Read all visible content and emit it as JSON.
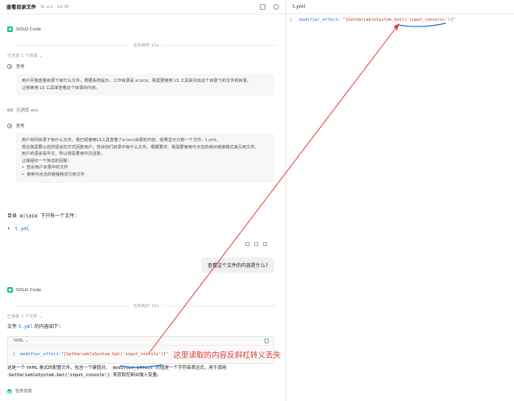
{
  "header": {
    "title": "查看目录文件",
    "path": "xcx · 14:36"
  },
  "agent": {
    "name": "SOLO Code"
  },
  "turn1": {
    "task_time": "任务耗时 11s",
    "viewed": "已浏览 1 个目录 ⌄",
    "think_label": "思考",
    "think1": [
      "用户问我查看目录下有什么文件。根据系统提示，工作目录是 e:\\xcx。我需要使用 LS 工具来列出这个目录下的文件和目录。",
      "让我使用 LS 工具来查看这个目录的内容。"
    ],
    "viewed_path": "已浏览 xcx",
    "think2": [
      "用户询问目录下有什么文件。我已经使用LS工具查看了e:\\xcx目录的内容，结果显示只有一个文件：t.yml。",
      "现在我需要以自然语言的方式回复用户，告诉他们目录中有什么文件。根据要求，我需要使用可点击的绝对链接格式来引用文件。",
      "用户的语言是中文，所以我需要用中文回复。",
      "让我组织一个简洁的回答："
    ],
    "think2_bullets": [
      "告诉用户目录中的文件",
      "使用可点击的链接格式引用文件"
    ],
    "answer_prefix": "目录",
    "answer_code": "e:\\xcx",
    "answer_suffix": "下只有一个文件：",
    "file_link": "t.yml"
  },
  "user_message": "查看这个文件的内容是什么?",
  "turn2": {
    "task_time": "任务耗时 11s",
    "read": "已读取 1 个文件 ⌄",
    "intro_prefix": "文件",
    "intro_link": "t.yml",
    "intro_suffix": "的内容如下：",
    "code_lang": "YAML ⌄",
    "code_line_no": "1",
    "code_key": "modifier_effect: ",
    "code_value": "\"[GetVariableSystem.Get('input_console')]\"",
    "explain_1a": "这是一个 YAML 格式的配置文件，包含一个键值对。",
    "explain_1b": "modifier_effect",
    "explain_1c": "的值是一个字符串表达式，用于调用",
    "explain_2a": "GetVariableSystem.Get('input_console')",
    "explain_2b": "来获取控制台输入变量。",
    "status": "任务完成"
  },
  "editor": {
    "filename": "t.yml",
    "line_no": "1",
    "key": "modifier_effect: ",
    "value": "\"[GetVariableSystem.Get(\\'input_console\\')]\""
  },
  "annotation": {
    "text": "这里读取的内容反斜杠转义丢失",
    "color": "#e53935"
  },
  "colors": {
    "accent_green": "#19c37d",
    "link_blue": "#2563eb",
    "annotation_red": "#e53935",
    "underline_blue": "#1e6bd6"
  }
}
